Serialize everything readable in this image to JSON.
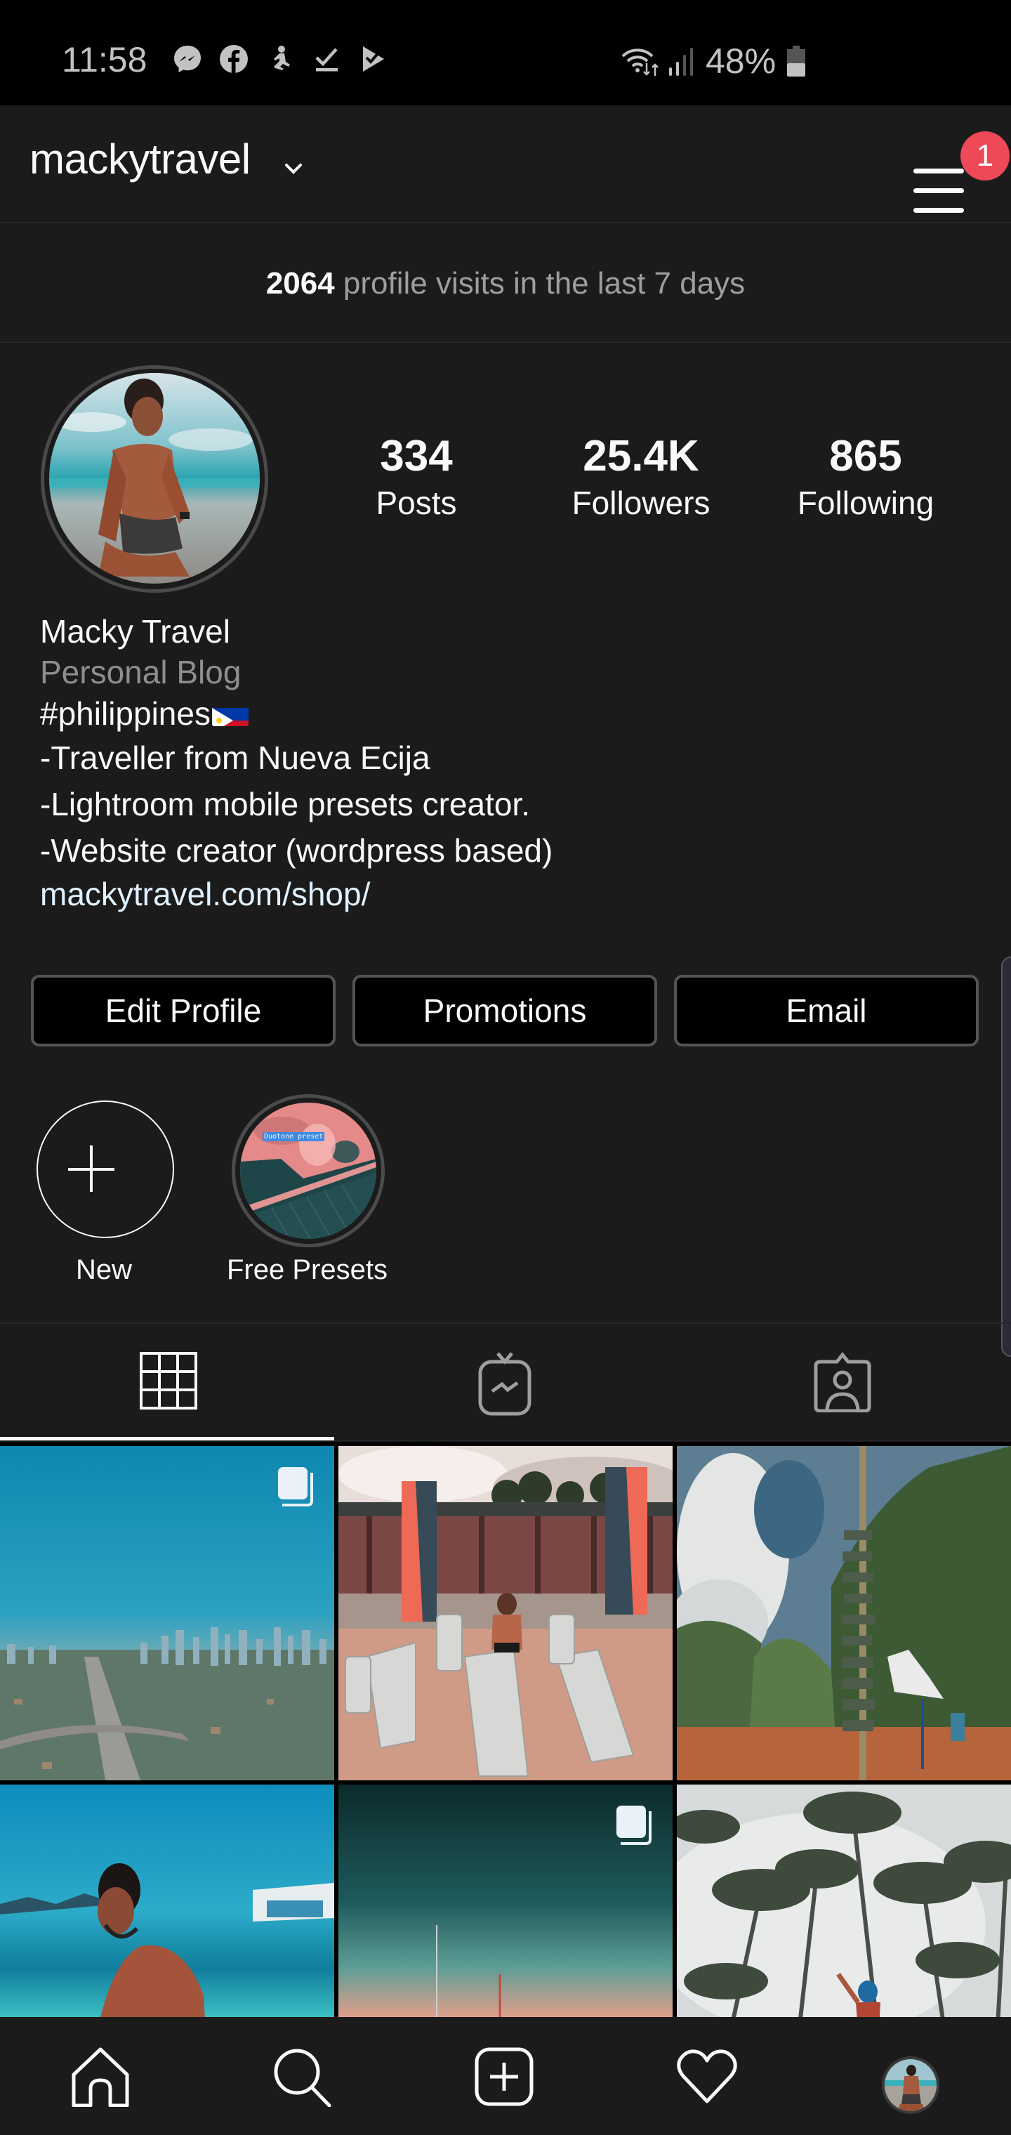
{
  "status_bar": {
    "time": "11:58",
    "notification_icons": [
      "messenger-icon",
      "facebook-icon",
      "fitness-icon",
      "download-done-icon",
      "play-store-update-icon"
    ],
    "system_icons": [
      "wifi-icon",
      "signal-icon",
      "battery-icon"
    ],
    "battery_percent": "48%",
    "battery_level": 0.48
  },
  "header": {
    "username": "mackytravel",
    "dropdown_icon": "chevron-down-icon",
    "menu_icon": "hamburger-menu-icon",
    "menu_badge_count": "1",
    "badge_color": "#ed4956"
  },
  "insights": {
    "visits_count": "2064",
    "visits_label": " profile visits in the last 7 days"
  },
  "profile": {
    "stats": [
      {
        "value": "334",
        "label": "Posts"
      },
      {
        "value": "25.4K",
        "label": "Followers"
      },
      {
        "value": "865",
        "label": "Following"
      }
    ],
    "name": "Macky Travel",
    "category": "Personal Blog",
    "bio_hashtag": "#philippines",
    "bio_flag": "philippines-flag-emoji",
    "bio_lines": [
      "-Traveller from Nueva Ecija",
      "-Lightroom mobile presets creator.",
      "-Website creator (wordpress based)"
    ],
    "website": "mackytravel.com/shop/",
    "link_color": "#e0f1ff"
  },
  "actions": {
    "edit_profile": "Edit Profile",
    "promotions": "Promotions",
    "email": "Email"
  },
  "highlights": [
    {
      "label": "New",
      "icon": "plus-icon"
    },
    {
      "label": "Free Presets",
      "thumb_caption": "Duotone preset"
    }
  ],
  "tabs": [
    {
      "name": "grid",
      "icon": "grid-icon",
      "active": true
    },
    {
      "name": "igtv",
      "icon": "igtv-icon",
      "active": false
    },
    {
      "name": "tagged",
      "icon": "tagged-person-icon",
      "active": false
    }
  ],
  "posts": [
    {
      "subject": "city skyline aerial",
      "multiple": true
    },
    {
      "subject": "beach loungers with umbrellas",
      "multiple": false
    },
    {
      "subject": "signpost among trees",
      "multiple": false
    },
    {
      "subject": "man at turquoise beach",
      "multiple": false
    },
    {
      "subject": "boats at dusk",
      "multiple": true
    },
    {
      "subject": "jump among palm trees",
      "multiple": false
    }
  ],
  "bottom_nav": [
    {
      "name": "home",
      "icon": "home-icon"
    },
    {
      "name": "search",
      "icon": "search-icon"
    },
    {
      "name": "new-post",
      "icon": "add-post-icon"
    },
    {
      "name": "activity",
      "icon": "heart-icon"
    },
    {
      "name": "profile",
      "icon": "profile-avatar"
    }
  ]
}
